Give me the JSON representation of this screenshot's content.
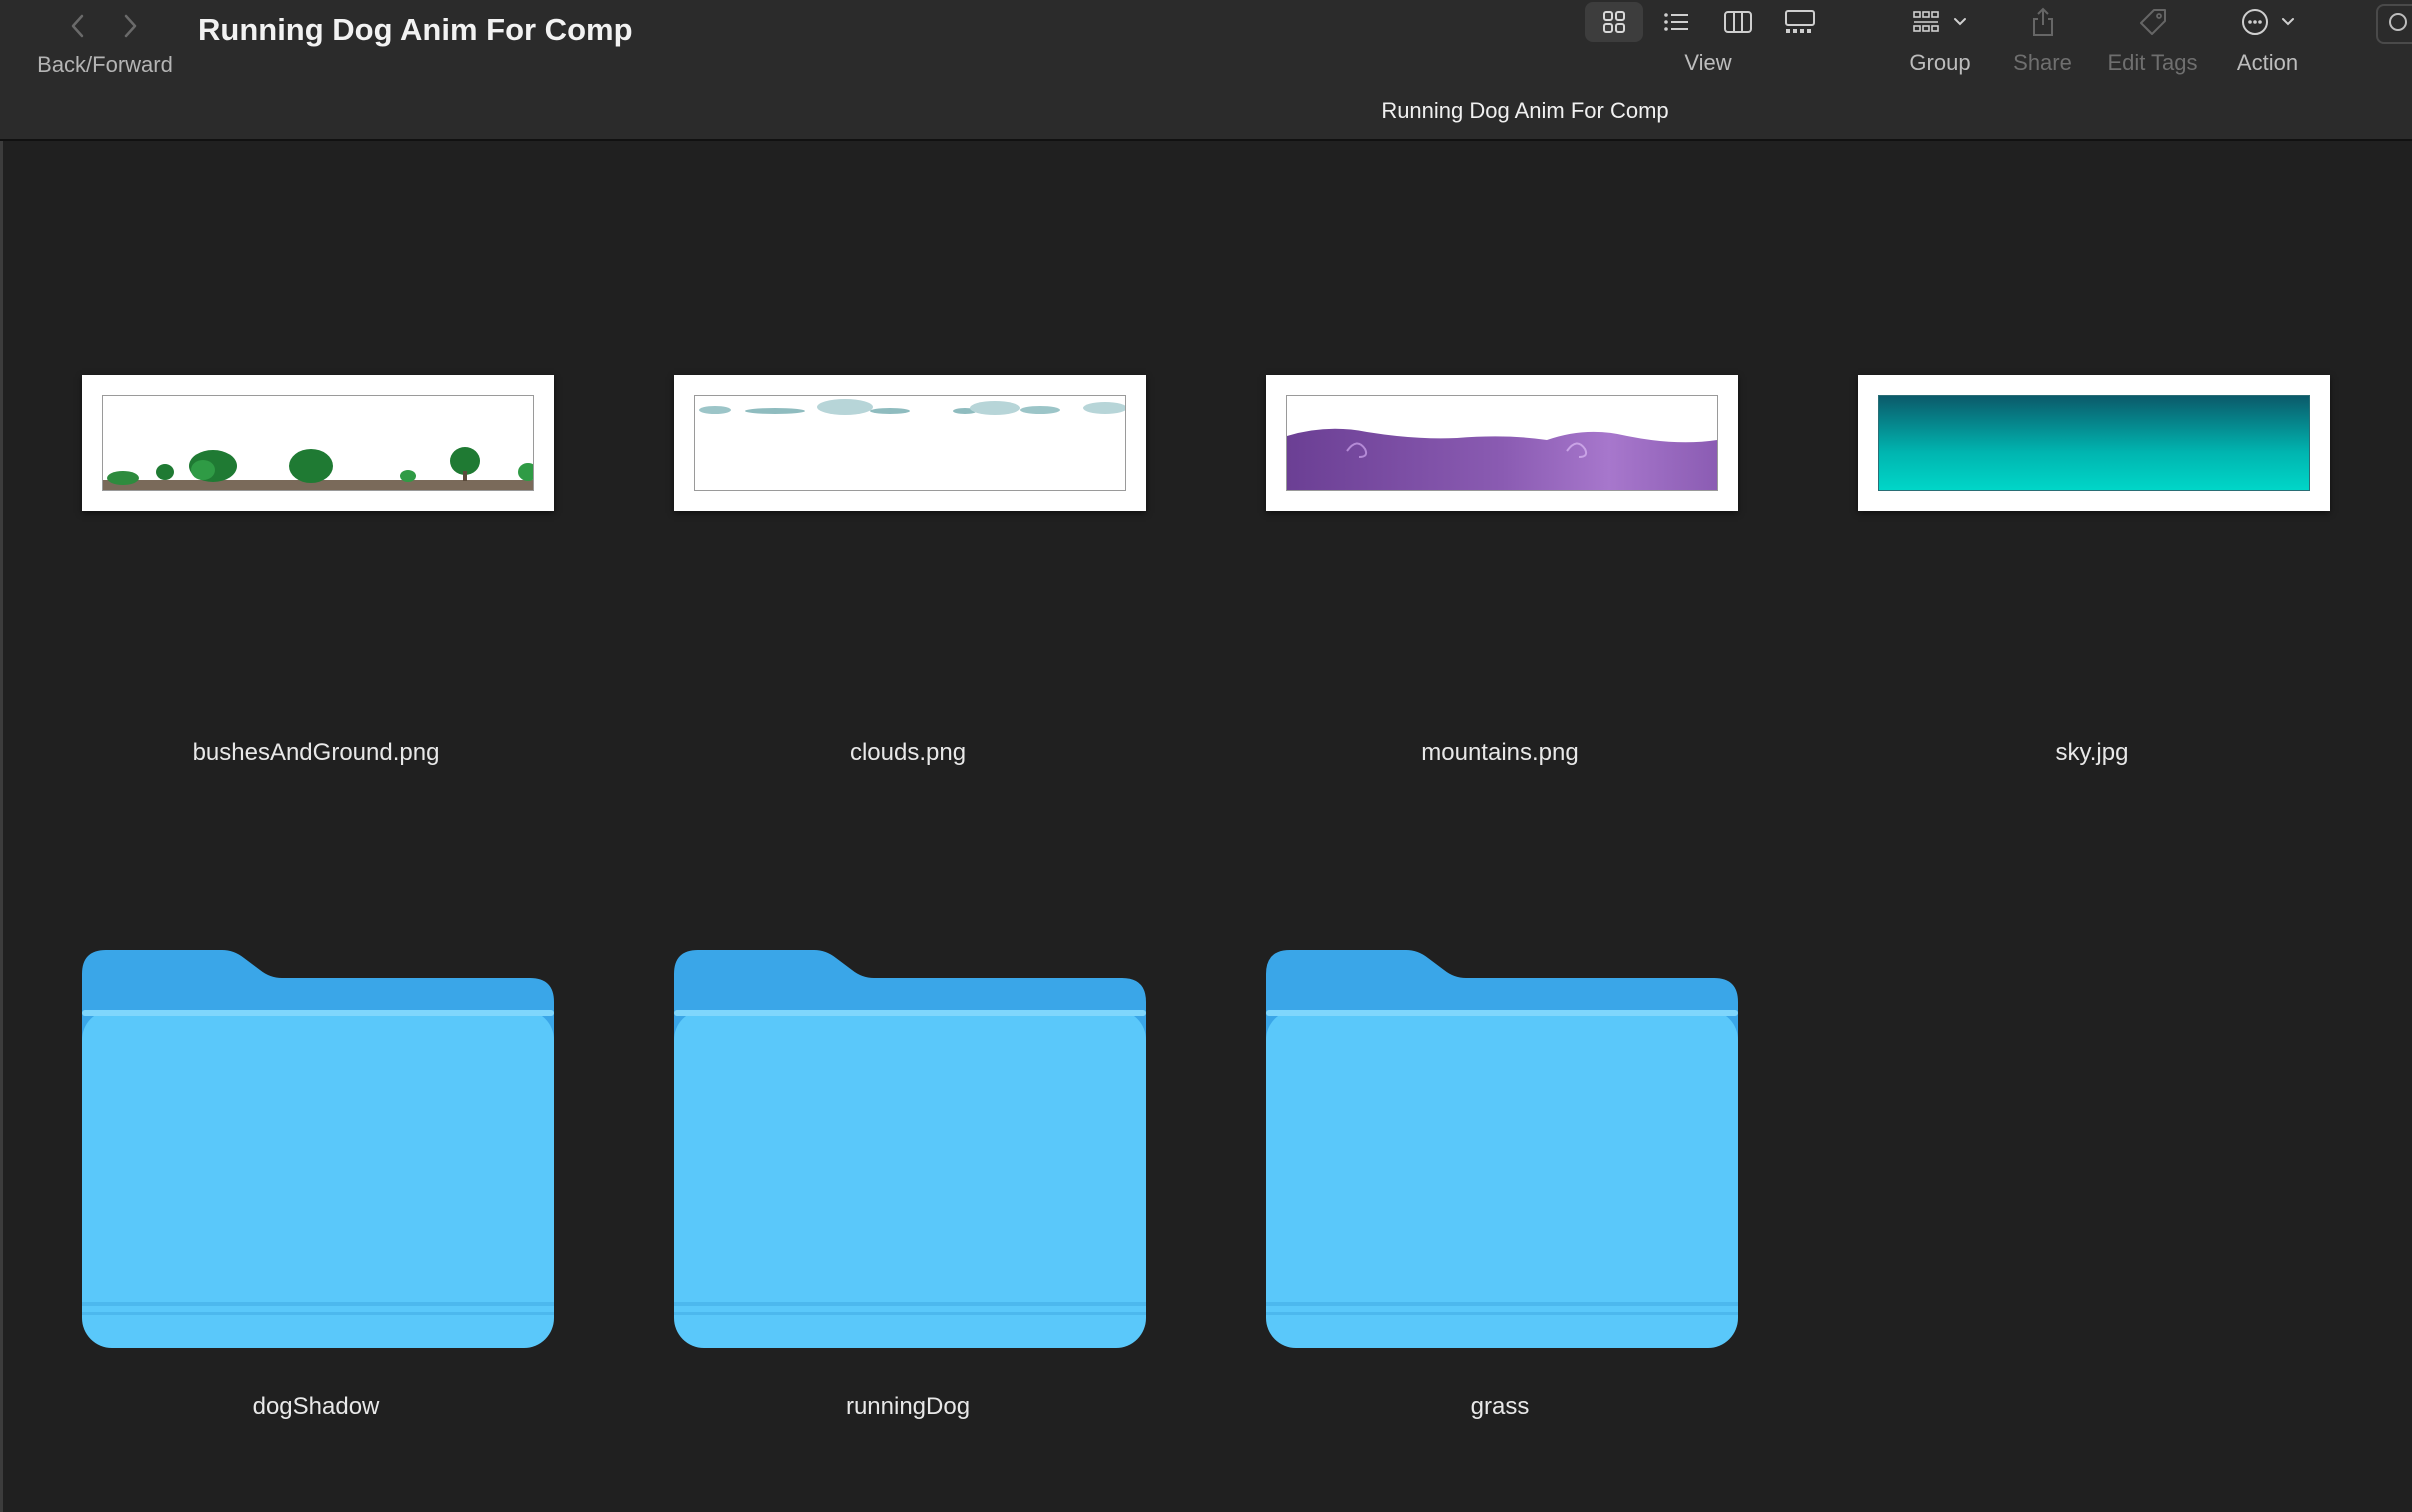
{
  "toolbar": {
    "nav_label": "Back/Forward",
    "title": "Running Dog Anim For Comp",
    "view_label": "View",
    "group_label": "Group",
    "share_label": "Share",
    "edit_tags_label": "Edit Tags",
    "action_label": "Action",
    "active_view": "icons"
  },
  "path_title": "Running Dog Anim For Comp",
  "files": [
    {
      "name": "bushesAndGround.png",
      "thumbnail": "bushes-and-ground"
    },
    {
      "name": "clouds.png",
      "thumbnail": "clouds"
    },
    {
      "name": "mountains.png",
      "thumbnail": "purple-mountains"
    },
    {
      "name": "sky.jpg",
      "thumbnail": "teal-gradient-sky"
    }
  ],
  "folders": [
    {
      "name": "dogShadow"
    },
    {
      "name": "runningDog"
    },
    {
      "name": "grass"
    }
  ],
  "colors": {
    "folder_front": "#5ac8fa",
    "folder_back": "#3aa6e8",
    "sky_top": "#0b5a6a",
    "sky_bottom": "#00d6c8",
    "mountain": "#7b4fa6"
  }
}
